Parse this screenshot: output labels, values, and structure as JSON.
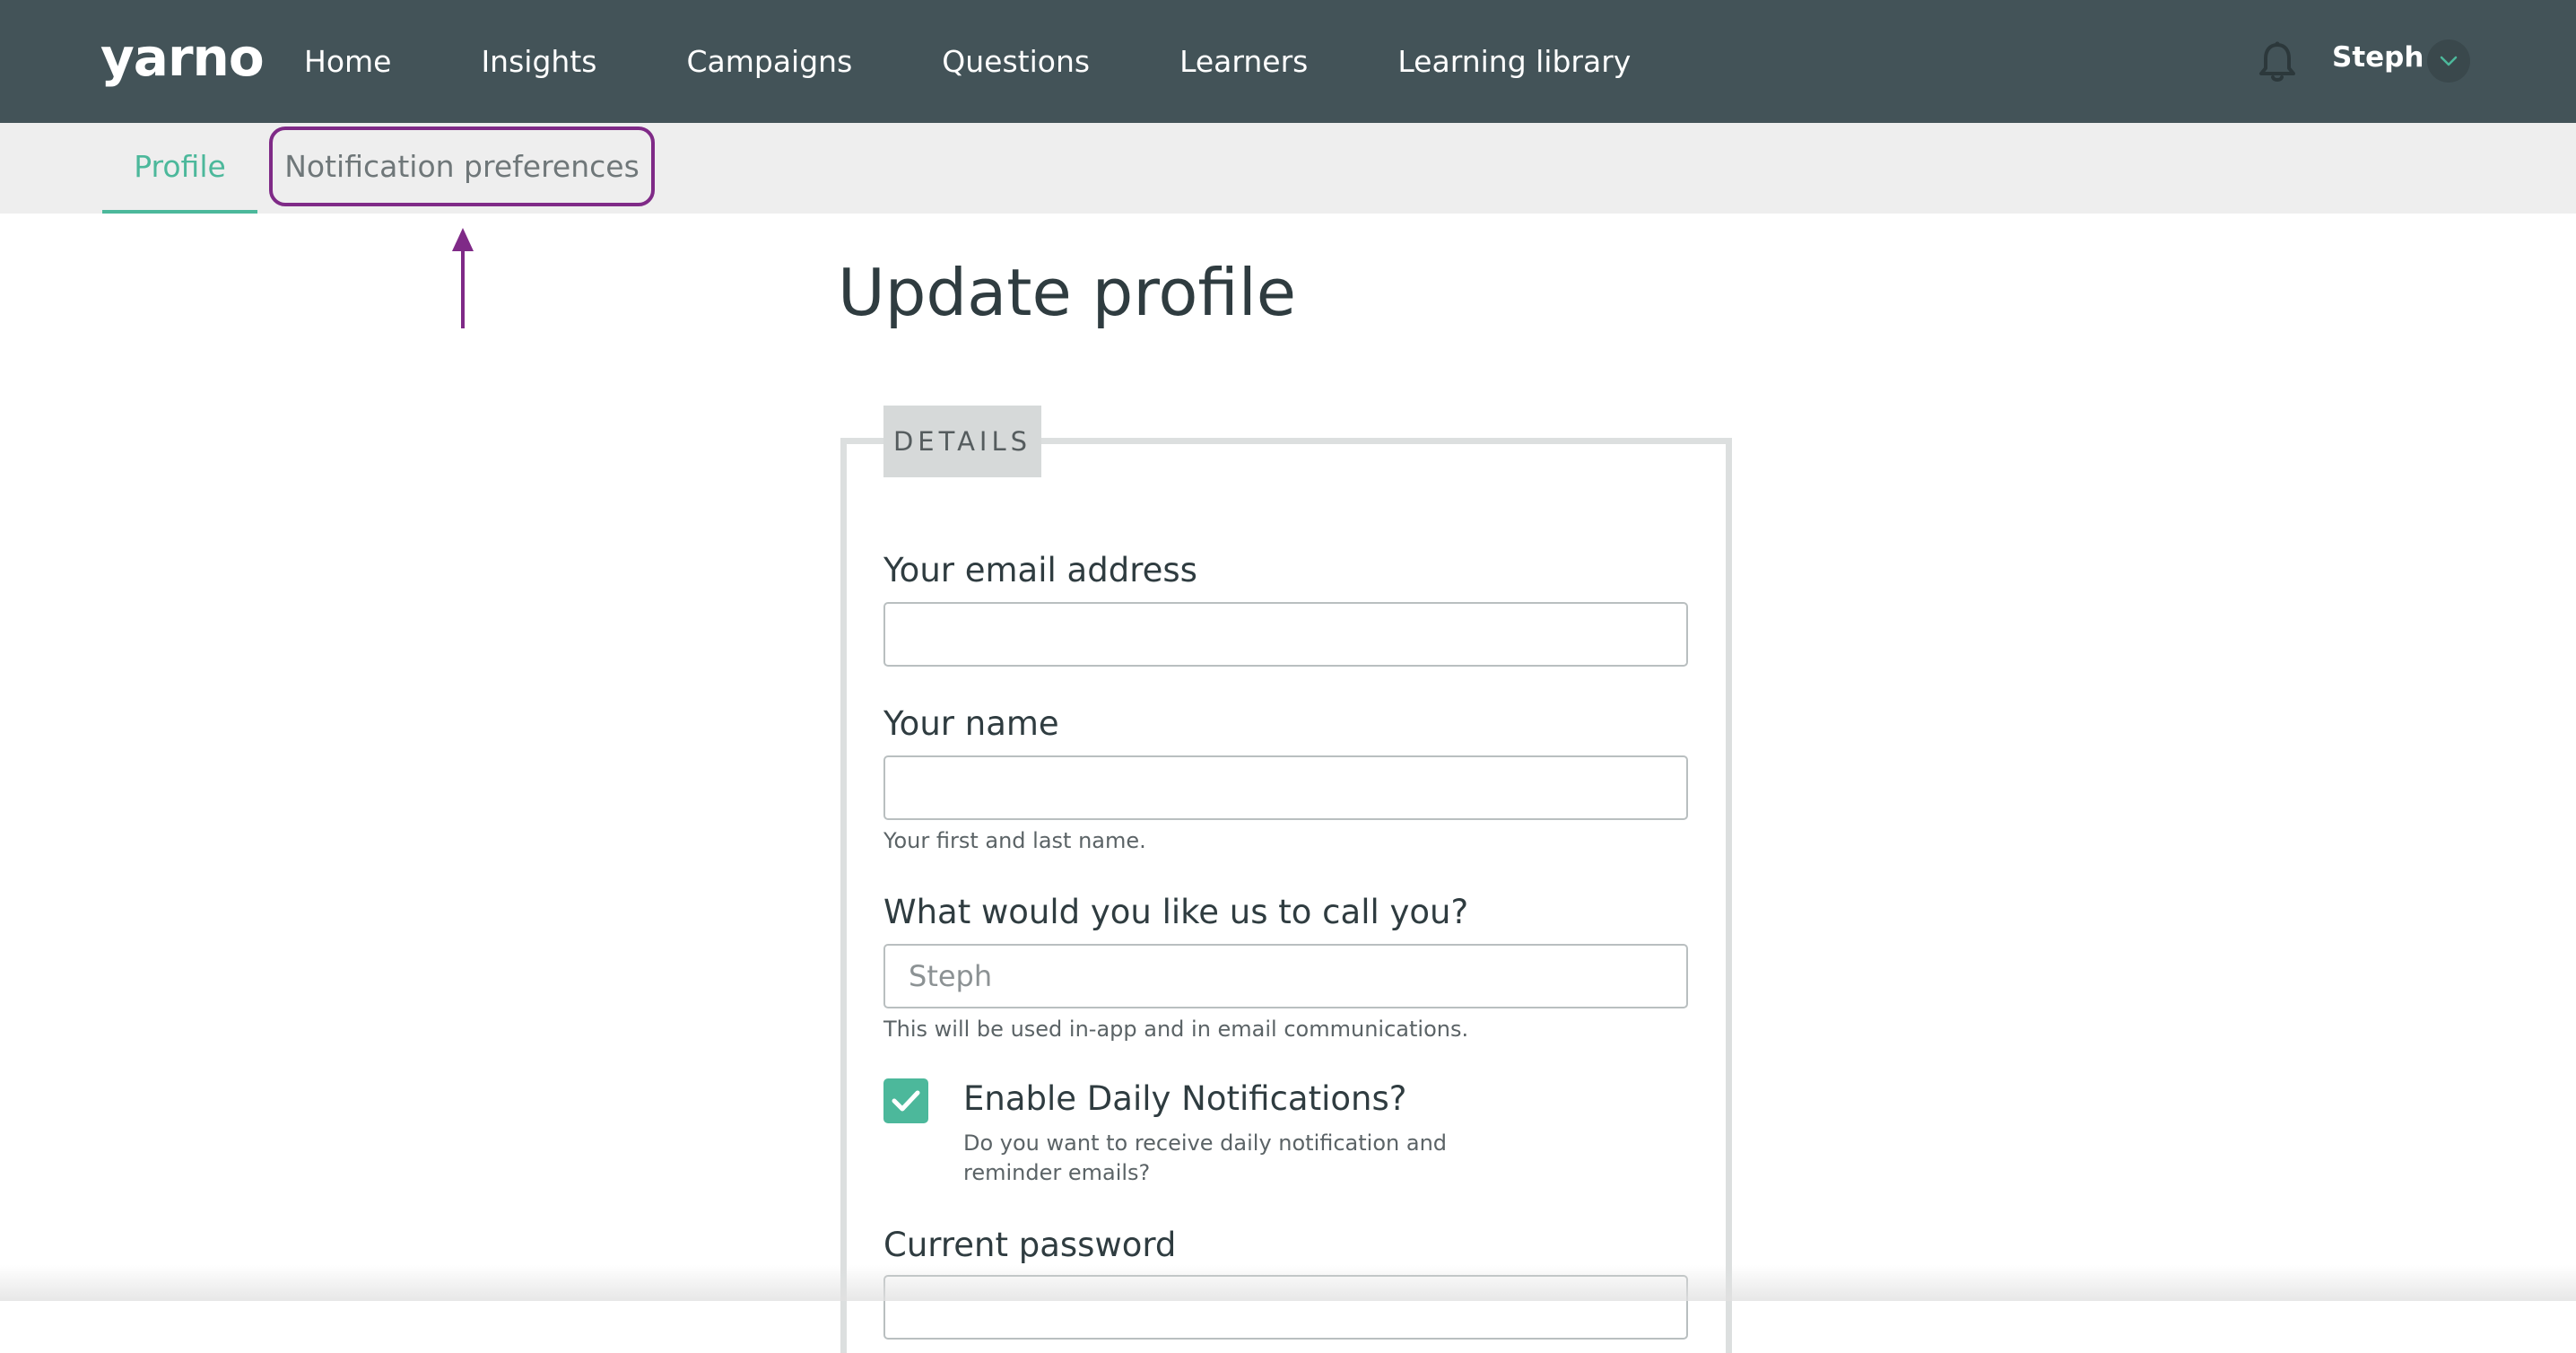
{
  "app": {
    "logo_text": "yarno",
    "nav": [
      {
        "label": "Home"
      },
      {
        "label": "Insights"
      },
      {
        "label": "Campaigns"
      },
      {
        "label": "Questions"
      },
      {
        "label": "Learners"
      },
      {
        "label": "Learning library"
      }
    ],
    "user": {
      "name": "Steph"
    }
  },
  "subnav": {
    "tabs": [
      {
        "label": "Profile",
        "active": true
      },
      {
        "label": "Notification preferences",
        "active": false
      }
    ]
  },
  "page": {
    "title": "Update profile",
    "section_label": "DETAILS",
    "fields": {
      "email": {
        "label": "Your email address",
        "value": "",
        "placeholder": ""
      },
      "name": {
        "label": "Your name",
        "value": "",
        "placeholder": "",
        "help": "Your first and last name."
      },
      "nickname": {
        "label": "What would you like us to call you?",
        "value": "",
        "placeholder": "Steph",
        "help": "This will be used in-app and in email communications."
      },
      "daily_notifications": {
        "label": "Enable Daily Notifications?",
        "checked": true,
        "help": "Do you want to receive daily notification and reminder emails?"
      },
      "current_password": {
        "label": "Current password"
      }
    }
  },
  "colors": {
    "topbar": "#435358",
    "subnav": "#eeeeee",
    "accent": "#4cb89b",
    "annotation": "#7f2a87",
    "text": "#2f3c40"
  },
  "icons": {
    "bell": "bell-icon",
    "caret": "chevron-down-icon",
    "check": "check-icon",
    "arrow": "arrow-up-icon"
  }
}
